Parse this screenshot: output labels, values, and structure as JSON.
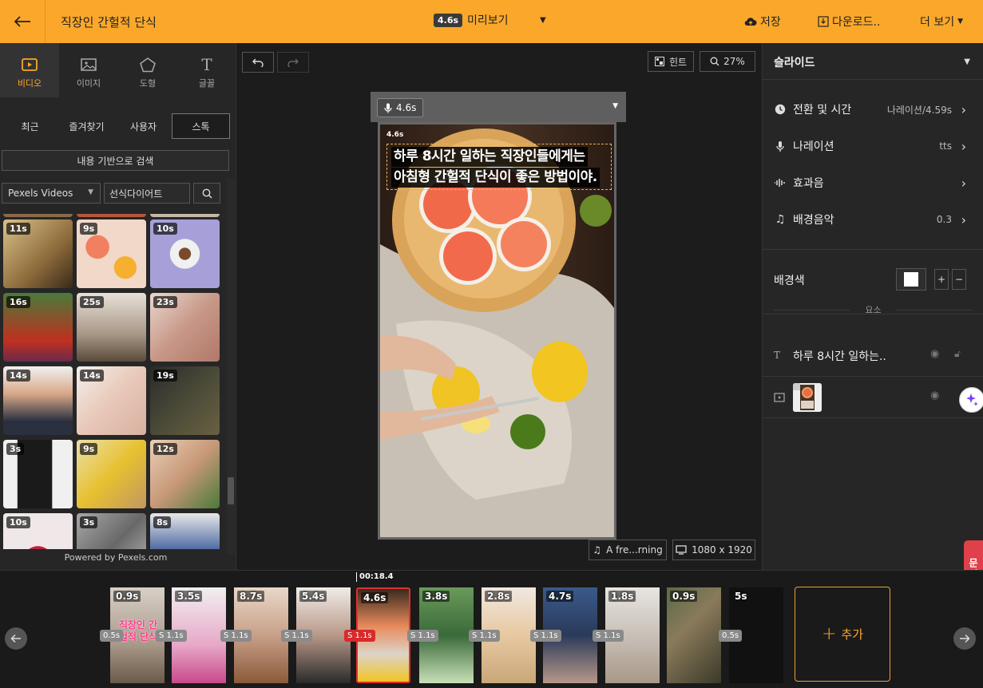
{
  "header": {
    "title": "직장인 간헐적 단식",
    "preview_duration": "4.6s",
    "preview_label": "미리보기",
    "save_label": "저장",
    "download_label": "다운로드..",
    "more_label": "더 보기"
  },
  "left_panel": {
    "categories": [
      {
        "label": "비디오",
        "icon": "video-icon",
        "active": true
      },
      {
        "label": "이미지",
        "icon": "image-icon"
      },
      {
        "label": "도형",
        "icon": "shape-icon"
      },
      {
        "label": "글꼴",
        "icon": "text-icon"
      }
    ],
    "sub_tabs": [
      "최근",
      "즐겨찾기",
      "사용자",
      "스톡"
    ],
    "active_sub_tab": "스톡",
    "content_search_label": "내용 기반으로 검색",
    "source_select": "Pexels Videos",
    "search_value": "선식다이어트",
    "thumbnails": [
      "11s",
      "9s",
      "10s",
      "16s",
      "25s",
      "23s",
      "14s",
      "14s",
      "19s",
      "3s",
      "9s",
      "12s",
      "10s",
      "3s",
      "8s"
    ],
    "powered_by": "Powered by Pexels.com"
  },
  "canvas_area": {
    "hint_label": "힌트",
    "zoom_label": "27%",
    "narration_duration": "4.6s",
    "caption_line1": "하루 8시간 일하는 직장인들에게는",
    "caption_line2": "아침형 간헐적 단식이 좋은 방법이야.",
    "canvas_mini_label": "4.6s",
    "music_label": "A fre...rning",
    "resolution_label": "1080 x 1920"
  },
  "right_panel": {
    "title": "슬라이드",
    "rows": [
      {
        "label": "전환 및 시간",
        "value": "나레이션/4.59s",
        "icon": "clock-icon"
      },
      {
        "label": "나레이션",
        "value": "tts",
        "icon": "mic-icon"
      },
      {
        "label": "효과음",
        "value": "",
        "icon": "soundwave-icon"
      },
      {
        "label": "배경음악",
        "value": "0.3",
        "icon": "music-icon"
      }
    ],
    "bg_color_label": "배경색",
    "bg_color": "#ffffff",
    "elements_label": "요소",
    "elements": [
      {
        "type": "text",
        "label": "하루 8시간 일하는.."
      },
      {
        "type": "video",
        "label": ""
      }
    ],
    "inquiry_label": "문의"
  },
  "timeline": {
    "playhead_time": "00:18.4",
    "clips": [
      {
        "duration": "0.9s",
        "transition": "0.5s"
      },
      {
        "duration": "3.5s",
        "transition": "S 1.1s"
      },
      {
        "duration": "8.7s",
        "transition": "S 1.1s"
      },
      {
        "duration": "5.4s",
        "transition": "S 1.1s"
      },
      {
        "duration": "4.6s",
        "transition": "S 1.1s",
        "active": true
      },
      {
        "duration": "3.8s",
        "transition": "S 1.1s"
      },
      {
        "duration": "2.8s",
        "transition": "S 1.1s"
      },
      {
        "duration": "4.7s",
        "transition": "S 1.1s"
      },
      {
        "duration": "1.8s",
        "transition": "S 1.1s"
      },
      {
        "duration": "0.9s",
        "transition": "0.5s"
      },
      {
        "duration": "5s",
        "transition": ""
      }
    ],
    "clip_title_overlay": "직장인 간헐적 단식",
    "add_label": "추가"
  },
  "colors": {
    "accent": "#fba82a",
    "active_clip": "#e03030",
    "background": "#1e1e1e"
  }
}
